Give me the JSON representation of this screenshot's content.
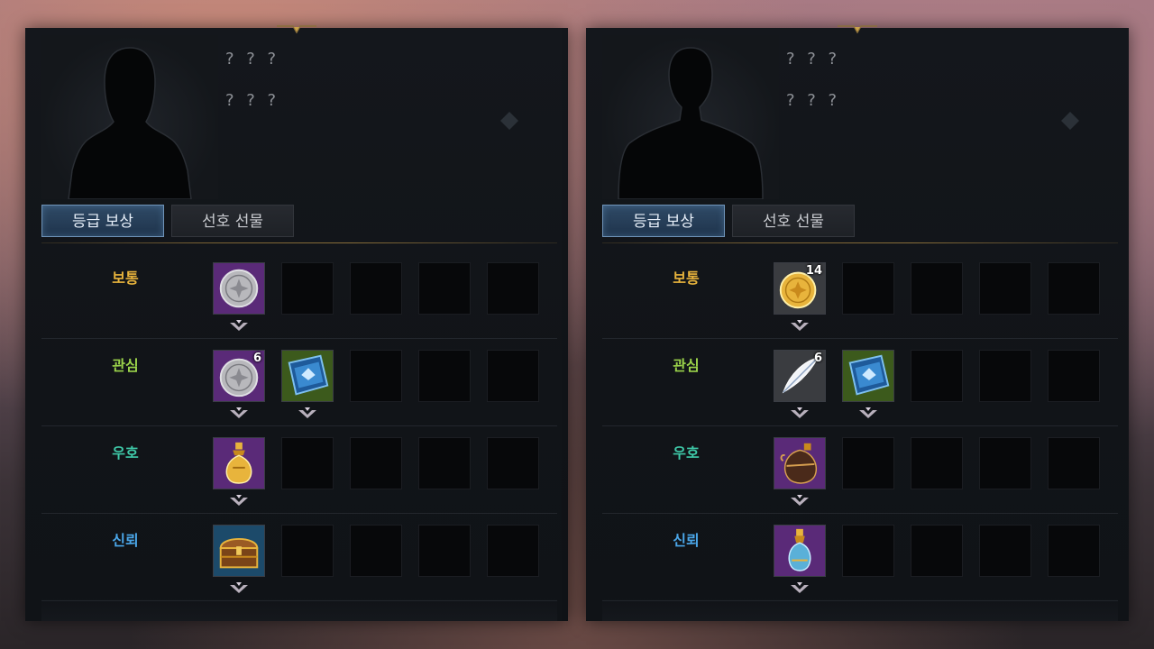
{
  "colors": {
    "tier_normal": "#e8b43c",
    "tier_interest": "#9ad24a",
    "tier_favor": "#3fc9a8",
    "tier_trust": "#4aa6e8",
    "bg_purple": "#5a2a78",
    "bg_green": "#3c5a1c",
    "bg_blue": "#1c4a6a",
    "bg_gray": "#3a3c40"
  },
  "left_panel": {
    "name": "? ? ?",
    "subtitle": "? ? ?",
    "tabs": {
      "active": "등급 보상",
      "inactive": "선호 선물"
    },
    "rows": [
      {
        "tier": "보통",
        "color_key": "tier_normal",
        "items": [
          {
            "icon": "silver-coin-icon",
            "bg": "purple",
            "qty": ""
          }
        ]
      },
      {
        "tier": "관심",
        "color_key": "tier_interest",
        "items": [
          {
            "icon": "silver-coin-icon",
            "bg": "purple",
            "qty": "6"
          },
          {
            "icon": "blue-book-icon",
            "bg": "green",
            "qty": ""
          }
        ]
      },
      {
        "tier": "우호",
        "color_key": "tier_favor",
        "items": [
          {
            "icon": "gold-perfume-icon",
            "bg": "purple",
            "qty": ""
          }
        ]
      },
      {
        "tier": "신뢰",
        "color_key": "tier_trust",
        "items": [
          {
            "icon": "treasure-chest-icon",
            "bg": "blue",
            "qty": ""
          }
        ]
      }
    ]
  },
  "right_panel": {
    "name": "? ? ?",
    "subtitle": "? ? ?",
    "tabs": {
      "active": "등급 보상",
      "inactive": "선호 선물"
    },
    "rows": [
      {
        "tier": "보통",
        "color_key": "tier_normal",
        "items": [
          {
            "icon": "gold-coin-icon",
            "bg": "gray",
            "qty": "14"
          }
        ]
      },
      {
        "tier": "관심",
        "color_key": "tier_interest",
        "items": [
          {
            "icon": "white-feather-icon",
            "bg": "gray",
            "qty": "6"
          },
          {
            "icon": "blue-book-icon",
            "bg": "green",
            "qty": ""
          }
        ]
      },
      {
        "tier": "우호",
        "color_key": "tier_favor",
        "items": [
          {
            "icon": "dark-perfume-icon",
            "bg": "purple",
            "qty": ""
          }
        ]
      },
      {
        "tier": "신뢰",
        "color_key": "tier_trust",
        "items": [
          {
            "icon": "blue-potion-icon",
            "bg": "purple",
            "qty": ""
          }
        ]
      }
    ]
  }
}
